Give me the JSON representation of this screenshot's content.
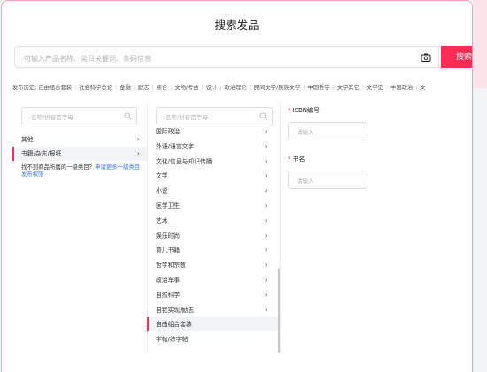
{
  "dialog": {
    "title": "搜索发品"
  },
  "search": {
    "placeholder": "可输入产品名称、类目关键词、条码信息",
    "button_label": "搜索"
  },
  "history": {
    "label": "发布历史:",
    "items": [
      "自由组合套装",
      "社会科学总论",
      "金融",
      "励志",
      "综合",
      "文物/考古",
      "设计",
      "政治理论",
      "民间文学/民族文学",
      "中国哲学",
      "文学其它",
      "文学史",
      "中国政治",
      "文"
    ]
  },
  "col1": {
    "search_placeholder": "名称/拼音首字母",
    "items": [
      {
        "label": "其他",
        "arrow": "›"
      },
      {
        "label": "书籍/杂志/报纸",
        "arrow": "›"
      }
    ],
    "hint_text": "找不到商品所属的一级类目？",
    "hint_link": "申请更多一级类目发布权限"
  },
  "col2": {
    "search_placeholder": "名称/拼音首字母",
    "items": [
      {
        "label": "国际政治",
        "arrow": "›"
      },
      {
        "label": "外语/语言文字",
        "arrow": "›"
      },
      {
        "label": "文化/信息与知识传播",
        "arrow": "›"
      },
      {
        "label": "文学",
        "arrow": "›"
      },
      {
        "label": "小说",
        "arrow": "›"
      },
      {
        "label": "医学卫生",
        "arrow": "›"
      },
      {
        "label": "艺术",
        "arrow": "›"
      },
      {
        "label": "娱乐时尚",
        "arrow": "›"
      },
      {
        "label": "育儿书籍",
        "arrow": "›"
      },
      {
        "label": "哲学和宗教",
        "arrow": "›"
      },
      {
        "label": "政治军事",
        "arrow": "›"
      },
      {
        "label": "自然科学",
        "arrow": "›"
      },
      {
        "label": "自我实现/励志",
        "arrow": "›"
      },
      {
        "label": "自由组合套装",
        "arrow": ""
      },
      {
        "label": "字帖/练字帖",
        "arrow": ""
      }
    ]
  },
  "form": {
    "isbn_label": "ISBN编号",
    "isbn_placeholder": "请输入",
    "book_label": "书名",
    "book_placeholder": "请输入",
    "required_mark": "*"
  },
  "icons": {
    "camera": "camera-icon",
    "search": "search-icon"
  },
  "colors": {
    "accent": "#fe2c55",
    "link": "#3d7eff"
  }
}
